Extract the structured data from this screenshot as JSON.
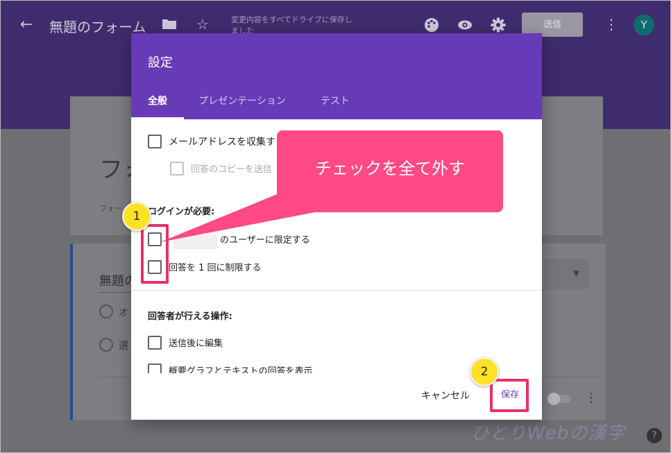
{
  "app": {
    "back_icon": "arrow-left-icon",
    "form_title": "無題のフォーム",
    "save_status": "変更内容をすべてドライブに保存しました",
    "send_label": "送信",
    "avatar_initial": "Y",
    "header_color": "#673ab7"
  },
  "form": {
    "title": "フォ",
    "description": "フォー",
    "question_title": "無題の",
    "option_1": "オ",
    "option_2": "選"
  },
  "dialog": {
    "title": "設定",
    "tabs": [
      {
        "label": "全般",
        "active": true
      },
      {
        "label": "プレゼンテーション",
        "active": false
      },
      {
        "label": "テスト",
        "active": false
      }
    ],
    "collect_email_label": "メールアドレスを収集す",
    "send_copy_label": "回答のコピーを送信",
    "login_required_heading": "ログインが必要:",
    "restrict_users_label": "のユーザーに限定する",
    "limit_one_response_label": "回答を 1 回に制限する",
    "respondent_actions_heading": "回答者が行える操作:",
    "edit_after_submit_label": "送信後に編集",
    "show_summary_label": "概要グラフとテキストの回答を表示",
    "cancel_label": "キャンセル",
    "save_label": "保存"
  },
  "annotations": {
    "callout_text": "チェックを全て外す",
    "badge_1": "1",
    "badge_2": "2",
    "highlight_color": "#e8306b",
    "callout_color": "#ff4a86",
    "badge_color": "#ffe226"
  },
  "watermark": "ひとりWebの漢字",
  "help_label": "?"
}
